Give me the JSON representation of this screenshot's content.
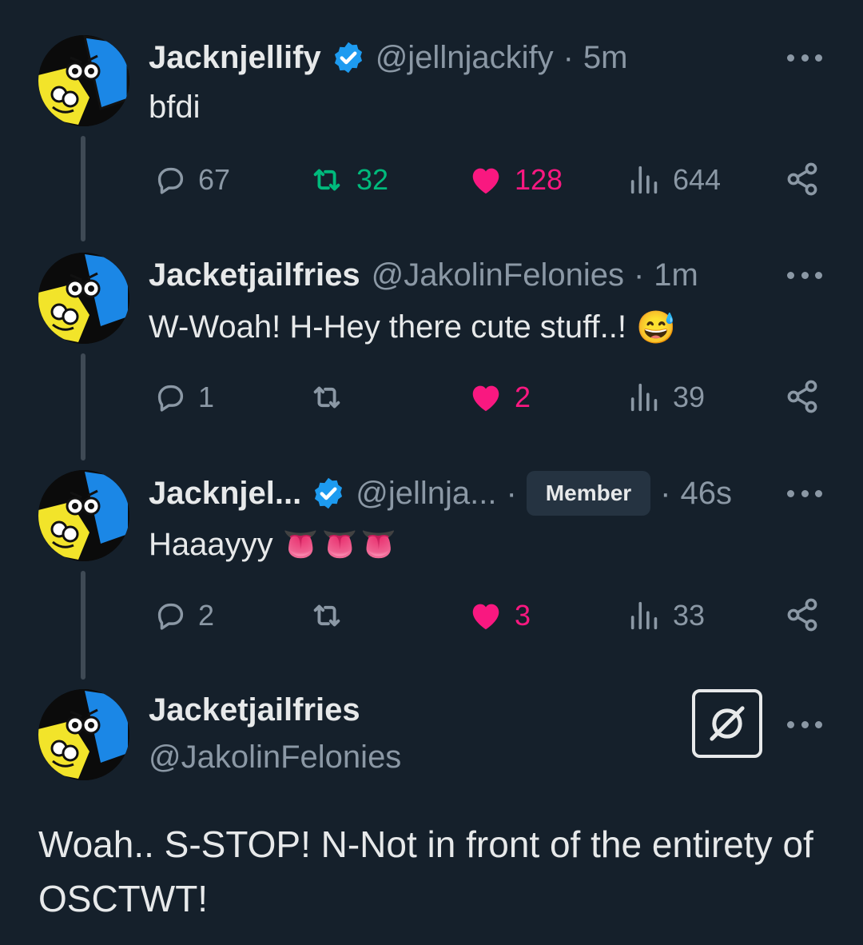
{
  "tweets": [
    {
      "name": "Jacknjellify",
      "handle": "@jellnjackify",
      "separator": "·",
      "time": "5m",
      "text": "bfdi",
      "replies": "67",
      "retweets": "32",
      "likes": "128",
      "views": "644"
    },
    {
      "name": "Jacketjailfries",
      "handle": "@JakolinFelonies",
      "separator": "·",
      "time": "1m",
      "text": "W-Woah! H-Hey there cute stuff..!",
      "emoji": "😅",
      "replies": "1",
      "retweets": "",
      "likes": "2",
      "views": "39"
    },
    {
      "name": "Jacknjel...",
      "handle": "@jellnja...",
      "separator": "·",
      "badge": "Member",
      "time": "46s",
      "text": "Haaayyy",
      "emoji": "👅👅👅",
      "replies": "2",
      "retweets": "",
      "likes": "3",
      "views": "33"
    }
  ],
  "main": {
    "name": "Jacketjailfries",
    "handle": "@JakolinFelonies",
    "text": "Woah.. S-STOP! N-Not in front of the entirety of OSCTWT!"
  },
  "icons": [
    "verified-badge-icon",
    "more-icon",
    "reply-icon",
    "retweet-icon",
    "like-icon",
    "views-icon",
    "share-icon",
    "grok-icon"
  ],
  "colors": {
    "background": "#15202b",
    "text": "#e7e9ea",
    "muted": "#8b98a5",
    "verified": "#1d9bf0",
    "retweet_active": "#00ba7c",
    "like_active": "#f91880"
  }
}
